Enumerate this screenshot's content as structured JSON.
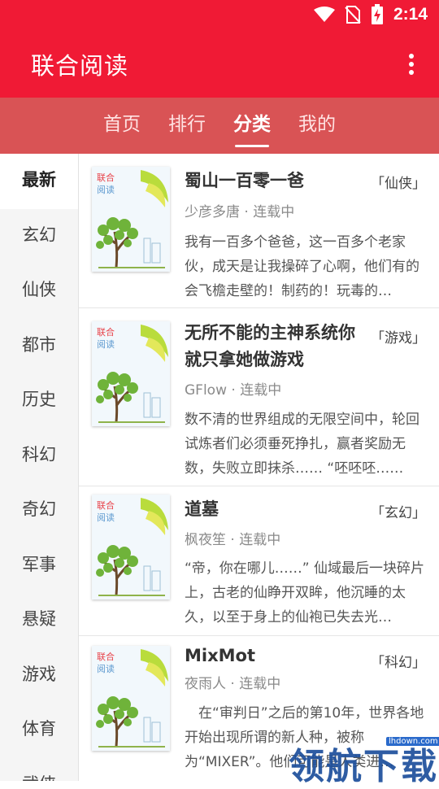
{
  "status": {
    "time": "2:14"
  },
  "app": {
    "title": "联合阅读"
  },
  "tabs": [
    {
      "label": "首页",
      "active": false
    },
    {
      "label": "排行",
      "active": false
    },
    {
      "label": "分类",
      "active": true
    },
    {
      "label": "我的",
      "active": false
    }
  ],
  "categories": [
    "最新",
    "玄幻",
    "仙侠",
    "都市",
    "历史",
    "科幻",
    "奇幻",
    "军事",
    "悬疑",
    "游戏",
    "体育",
    "武侠"
  ],
  "cover_brand": {
    "line1": "联合",
    "line2": "阅读"
  },
  "books": [
    {
      "title": "蜀山一百零一爸",
      "genre": "「仙侠」",
      "meta": "少彦多唐 · 连载中",
      "desc": "我有一百多个爸爸，这一百多个老家伙，成天是让我操碎了心啊，他们有的会飞檐走壁的！制药的！玩毒的…"
    },
    {
      "title": "无所不能的主神系统你就只拿她做游戏",
      "genre": "「游戏」",
      "meta": "GFlow · 连载中",
      "desc": "数不清的世界组成的无限空间中，轮回试炼者们必须垂死挣扎，赢者奖励无数，失败立即抹杀…… “呸呸呸……"
    },
    {
      "title": "道墓",
      "genre": "「玄幻」",
      "meta": "枫夜笙 · 连载中",
      "desc": "“帝，你在哪儿……” 仙域最后一块碎片上，古老的仙睁开双眸，他沉睡的太久，以至于身上的仙袍已失去光…"
    },
    {
      "title": "MixMot",
      "genre": "「科幻」",
      "meta": "夜雨人 · 连载中",
      "desc": "　在“审判日”之后的第10年，世界各地开始出现所谓的新人种，被称为“MIXER”。他们可能是人类进…"
    }
  ],
  "watermark": {
    "text": "领航下载",
    "url": "lhdown.com"
  },
  "colors": {
    "primary": "#f01a35",
    "tabbar": "#d95355"
  }
}
